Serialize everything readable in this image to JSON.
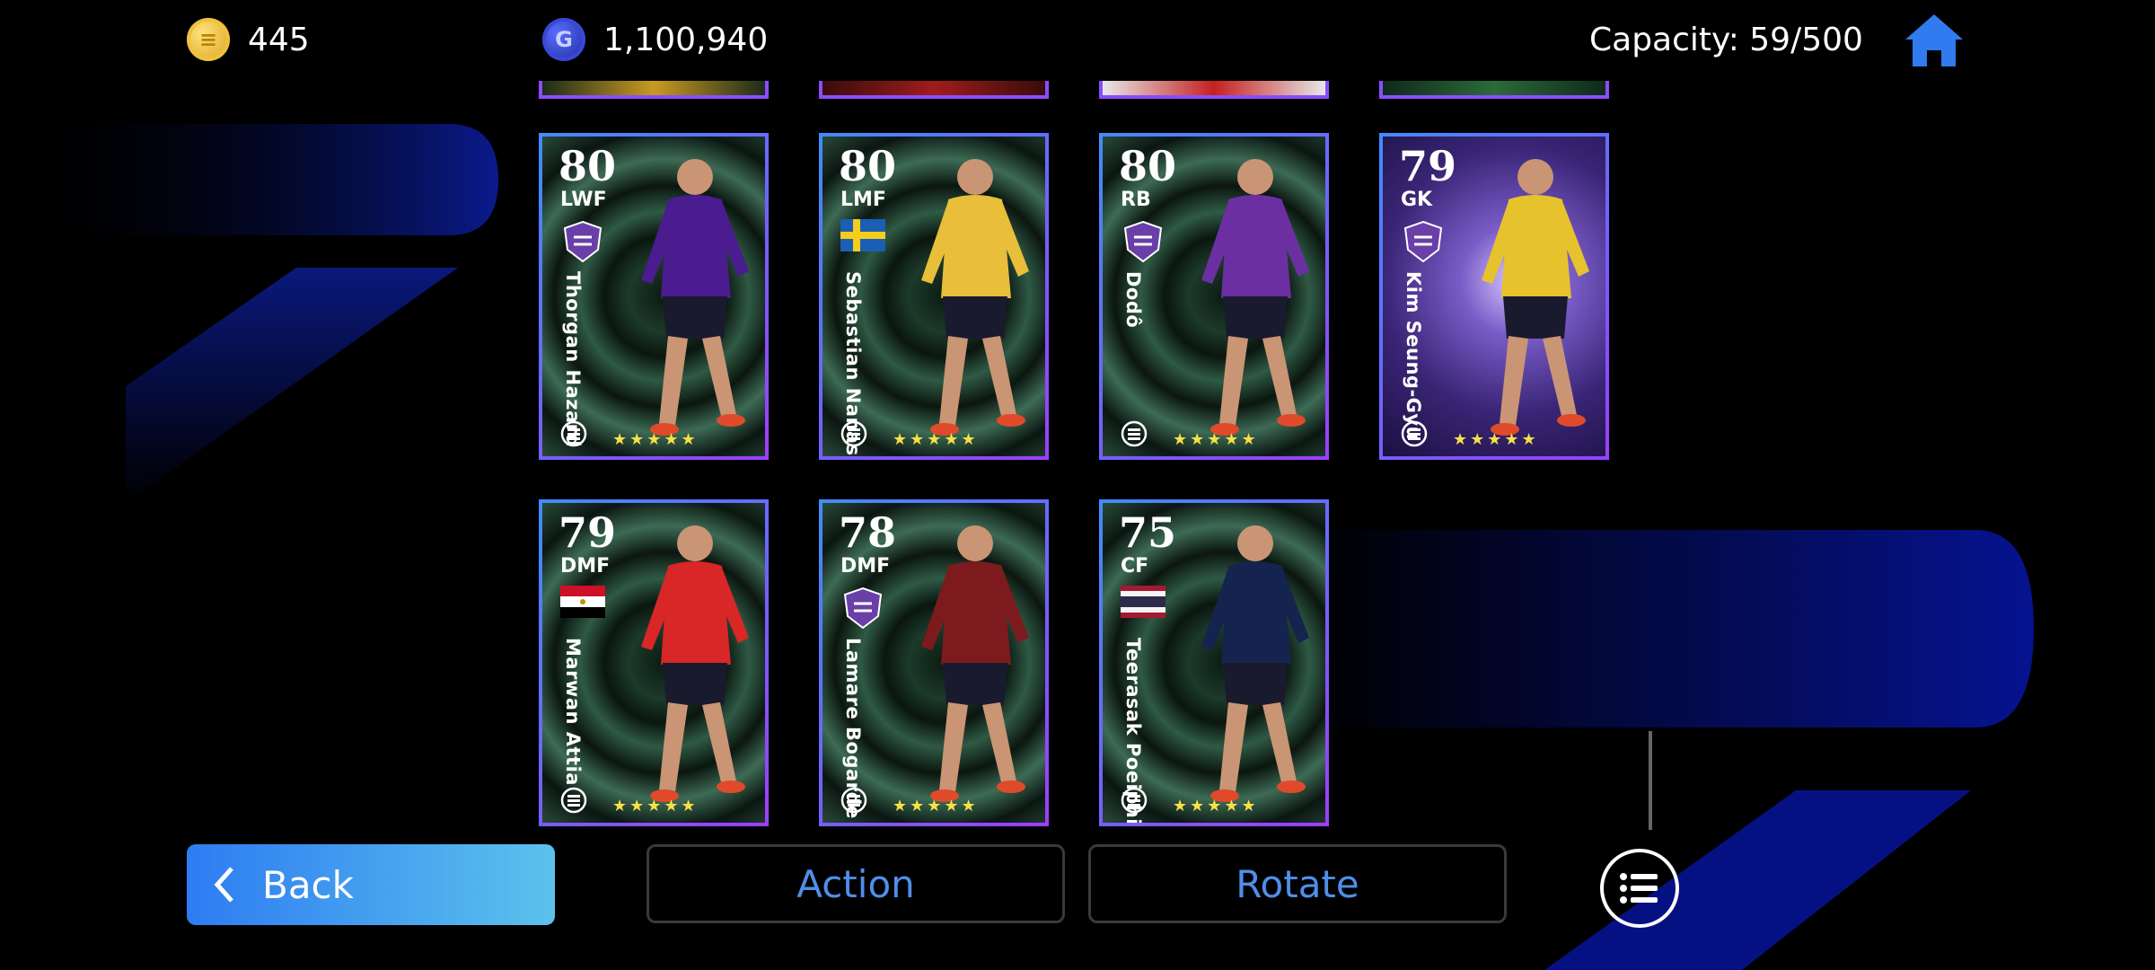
{
  "hud": {
    "coins": "445",
    "gp": "1,100,940",
    "capacity": "Capacity: 59/500"
  },
  "cards": [
    {
      "rating": "80",
      "position": "LWF",
      "name": "Thorgan Hazard",
      "badge": "club-crest",
      "kit": "#4a1c8f",
      "bg": "green"
    },
    {
      "rating": "80",
      "position": "LMF",
      "name": "Sebastian Nanasi",
      "badge": "sweden-flag",
      "kit": "#e8be3a",
      "bg": "green"
    },
    {
      "rating": "80",
      "position": "RB",
      "name": "Dodô",
      "badge": "club-crest",
      "kit": "#6b2fa2",
      "bg": "green"
    },
    {
      "rating": "79",
      "position": "GK",
      "name": "Kim Seung-Gyu",
      "badge": "club-crest",
      "kit": "#e6c22c",
      "bg": "purple"
    },
    {
      "rating": "79",
      "position": "DMF",
      "name": "Marwan Attia",
      "badge": "egypt-flag",
      "kit": "#d92626",
      "bg": "green"
    },
    {
      "rating": "78",
      "position": "DMF",
      "name": "Lamare Bogarde",
      "badge": "club-crest",
      "kit": "#7d1a1e",
      "bg": "green"
    },
    {
      "rating": "75",
      "position": "CF",
      "name": "Teerasak Poeiphimai",
      "badge": "thailand-flag",
      "kit": "#15244f",
      "bg": "green"
    }
  ],
  "stars": "★★★★★",
  "buttons": {
    "back": "Back",
    "action": "Action",
    "rotate": "Rotate"
  },
  "icons": [
    "e-coin-icon",
    "gp-coin-icon",
    "home-icon",
    "chevron-left-icon",
    "list-icon",
    "efootball-logo-icon"
  ],
  "colors": {
    "accent": "#2f7bef",
    "button_text": "#4f8fe8",
    "back_gradient_start": "#2e7cf2",
    "back_gradient_end": "#5bc2ec",
    "star": "#f7e046",
    "card_border_start": "#3f8cff",
    "card_border_end": "#9b3fff"
  }
}
